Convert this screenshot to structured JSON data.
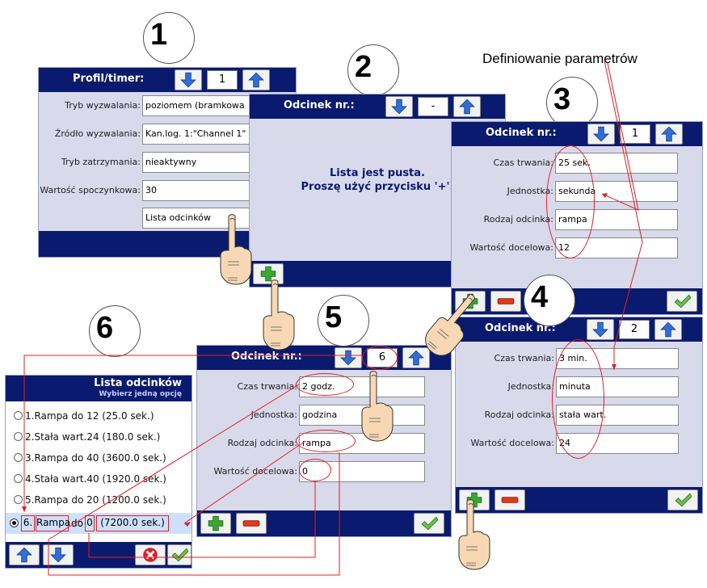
{
  "annotation_label": "Definiowanie parametrów",
  "step_numbers": [
    "1",
    "2",
    "3",
    "4",
    "5",
    "6"
  ],
  "panel1": {
    "title": "Profil/timer:",
    "counter": "1",
    "fields": [
      {
        "label": "Tryb wyzwalania:",
        "value": "poziomem (bramkowa"
      },
      {
        "label": "Źródło wyzwalania:",
        "value": "Kan.log. 1:\"Channel 1\""
      },
      {
        "label": "Tryb zatrzymania:",
        "value": "nieaktywny"
      },
      {
        "label": "Wartość spoczynkowa:",
        "value": "30"
      }
    ],
    "list_button": "Lista odcinków"
  },
  "panel2": {
    "title": "Odcinek nr.:",
    "counter": "-",
    "empty_line1": "Lista jest pusta.",
    "empty_line2": "Proszę użyć przycisku '+'."
  },
  "panel3": {
    "title": "Odcinek nr.:",
    "counter": "1",
    "fields": [
      {
        "label": "Czas trwania:",
        "value": "25 sek."
      },
      {
        "label": "Jednostka:",
        "value": "sekunda"
      },
      {
        "label": "Rodzaj odcinka:",
        "value": "rampa"
      },
      {
        "label": "Wartość docelowa:",
        "value": "12"
      }
    ]
  },
  "panel4": {
    "title": "Odcinek nr.:",
    "counter": "2",
    "fields": [
      {
        "label": "Czas trwania:",
        "value": "3 min."
      },
      {
        "label": "Jednostka:",
        "value": "minuta"
      },
      {
        "label": "Rodzaj odcinka:",
        "value": "stała wart."
      },
      {
        "label": "Wartość docelowa:",
        "value": "24"
      }
    ]
  },
  "panel5": {
    "title": "Odcinek nr.:",
    "counter": "6",
    "fields": [
      {
        "label": "Czas trwania:",
        "value": "2 godz."
      },
      {
        "label": "Jednostka:",
        "value": "godzina"
      },
      {
        "label": "Rodzaj odcinka:",
        "value": "rampa"
      },
      {
        "label": "Wartość docelowa:",
        "value": "0"
      }
    ]
  },
  "panel6": {
    "title": "Lista odcinków",
    "subtitle": "Wybierz jedną opcję",
    "items": [
      "1.Rampa do 12 (25.0 sek.)",
      "2.Stała wart.24 (180.0 sek.)",
      "3.Rampa do 40 (3600.0 sek.)",
      "4.Stała wart.40 (1920.0 sek.)",
      "5.Rampa do 20 (1200.0 sek.)"
    ],
    "selected": {
      "num": "6.",
      "kind": "Rampa",
      "mid": "do",
      "target": "0",
      "time": "(7200.0 sek.)"
    }
  },
  "colors": {
    "header": "#0a1a6e",
    "panel": "#d9d9ec",
    "highlight": "#e02020",
    "add": "#3aa832",
    "remove": "#e03a1a",
    "ok": "#2e9a2e"
  }
}
